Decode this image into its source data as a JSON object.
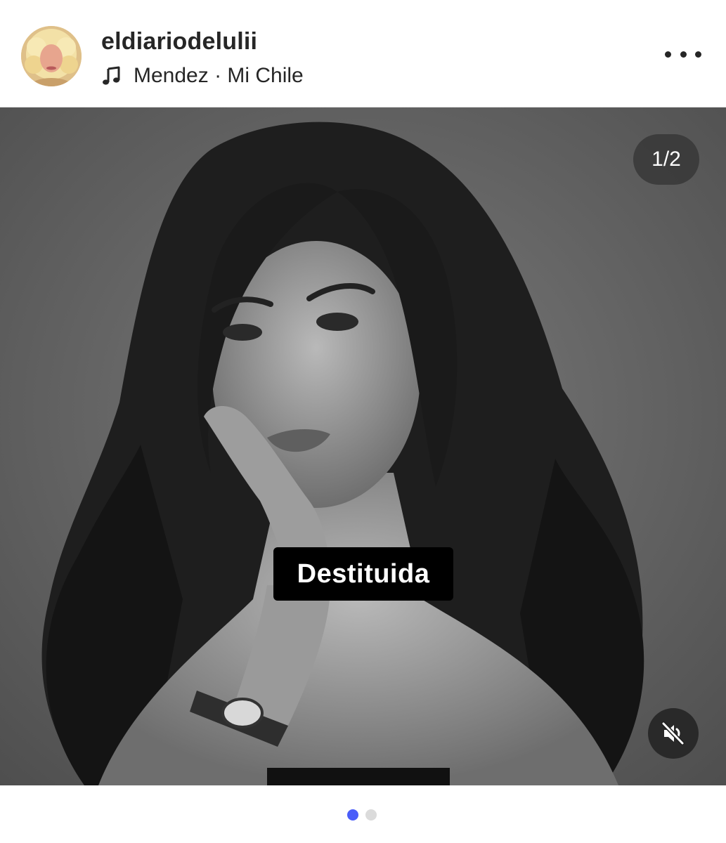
{
  "post": {
    "username": "eldiariodelulii",
    "music": "Mendez · Mi Chile",
    "more_icon": "more-horizontal-icon"
  },
  "media": {
    "counter": "1/2",
    "caption": "Destituida",
    "mute_icon": "muted-speaker-icon",
    "pagination": {
      "count": 2,
      "active": 1
    }
  },
  "colors": {
    "accent": "#4a5df9",
    "text": "#262626",
    "divider": "#dbdbdb"
  }
}
